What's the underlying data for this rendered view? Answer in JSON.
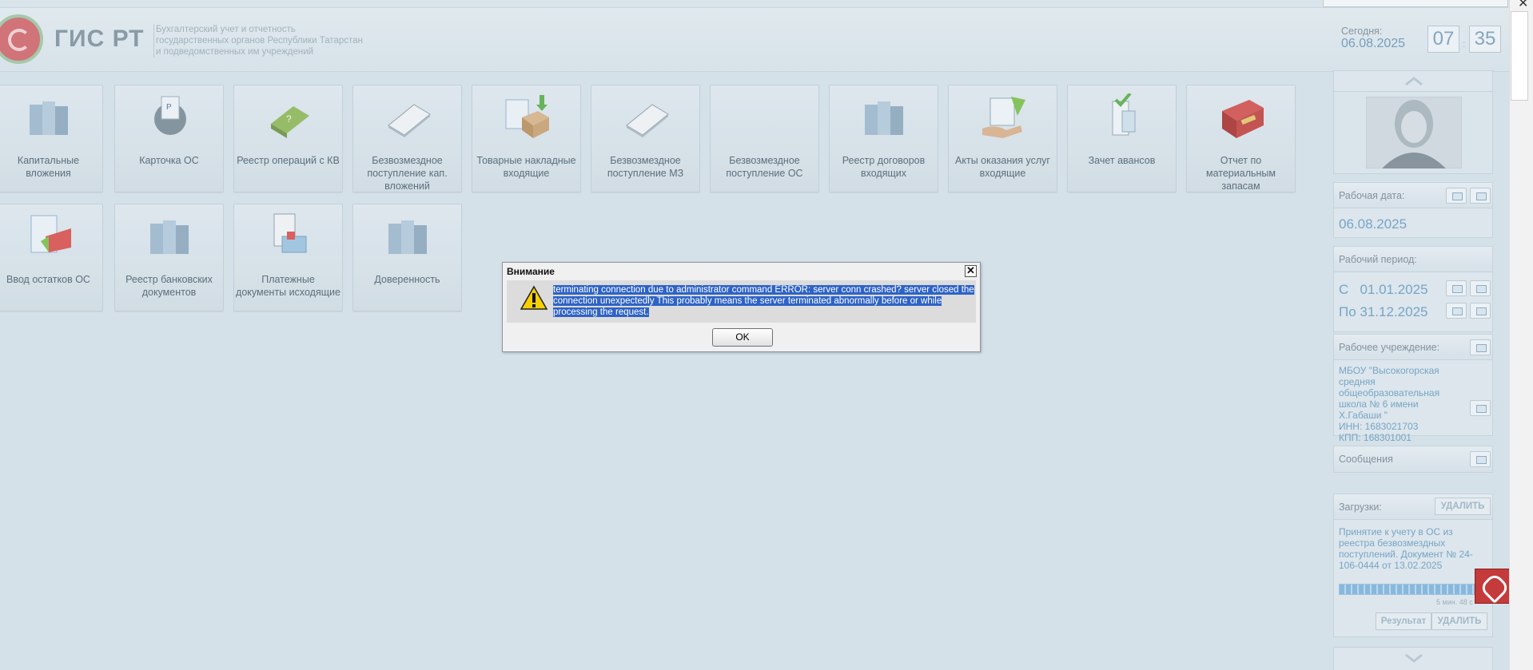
{
  "header": {
    "app_title": "ГИС РТ",
    "subtitle_lines": [
      "Бухгалтерский учет и отчетность",
      "государственных органов Республики Татарстан",
      "и подведомственных им учреждений"
    ],
    "today_label": "Сегодня:",
    "today_date": "06.08.2025",
    "clock_hours": "07",
    "clock_minutes": "35",
    "clock_separator": ":"
  },
  "tiles": [
    {
      "label": "Капитальные вложения",
      "icon": "folders-icon"
    },
    {
      "label": "Карточка ОС",
      "icon": "rolodex-icon"
    },
    {
      "label": "Реестр операций с КВ",
      "icon": "book-icon"
    },
    {
      "label": "Безвозмездное поступление кап. вложений",
      "icon": "document-stack-icon"
    },
    {
      "label": "Товарные накладные входящие",
      "icon": "incoming-box-icon"
    },
    {
      "label": "Безвозмездное поступление МЗ",
      "icon": "document-stack-icon"
    },
    {
      "label": "Безвозмездное поступление ОС",
      "icon": "blank-icon"
    },
    {
      "label": "Реестр договоров входящих",
      "icon": "folders-icon"
    },
    {
      "label": "Акты оказания услуг входящие",
      "icon": "hand-document-icon"
    },
    {
      "label": "Зачет авансов",
      "icon": "receipt-icon"
    },
    {
      "label": "Отчет по материальным запасам",
      "icon": "red-books-icon"
    },
    {
      "label": "Ввод остатков ОС",
      "icon": "document-pencil-icon"
    },
    {
      "label": "Реестр банковских документов",
      "icon": "folders-icon"
    },
    {
      "label": "Платежные документы исходящие",
      "icon": "outgoing-docs-icon"
    },
    {
      "label": "Доверенность",
      "icon": "folders-icon"
    }
  ],
  "right_panel": {
    "work_date_label": "Рабочая дата:",
    "work_date": "06.08.2025",
    "work_period_label": "Рабочий период:",
    "period_from": "С   01.01.2025",
    "period_to": "По 31.12.2025",
    "institution_label": "Рабочее учреждение:",
    "institution_name": "МБОУ \"Высокогорская средняя общеобразовательная школа № 6 имени Х.Габаши \"",
    "inn": "ИНН: 1683021703",
    "kpp": "КПП: 168301001",
    "messages_label": "Сообщения",
    "downloads_label": "Загрузки:",
    "delete_label": "УДАЛИТЬ",
    "download_item_text": "Принятие к учету в ОС из реестра безвозмездных поступлений. Документ № 24-106-0444 от 13.02.2025",
    "download_time": "5 мин. 48 с",
    "download_progress": 1.0,
    "result_label": "Результат",
    "delete_item_label": "УДАЛИТЬ"
  },
  "dialog": {
    "title": "Внимание",
    "close_glyph": "✕",
    "message": "terminating connection due to administrator command ERROR: server conn crashed? server closed the connection unexpectedly This probably means the server terminated abnormally before or while processing the request.",
    "ok_label": "OK"
  },
  "colors": {
    "background": "#d5e1e8",
    "accent_blue": "#6d9ec2",
    "selection": "#2e63c6"
  }
}
